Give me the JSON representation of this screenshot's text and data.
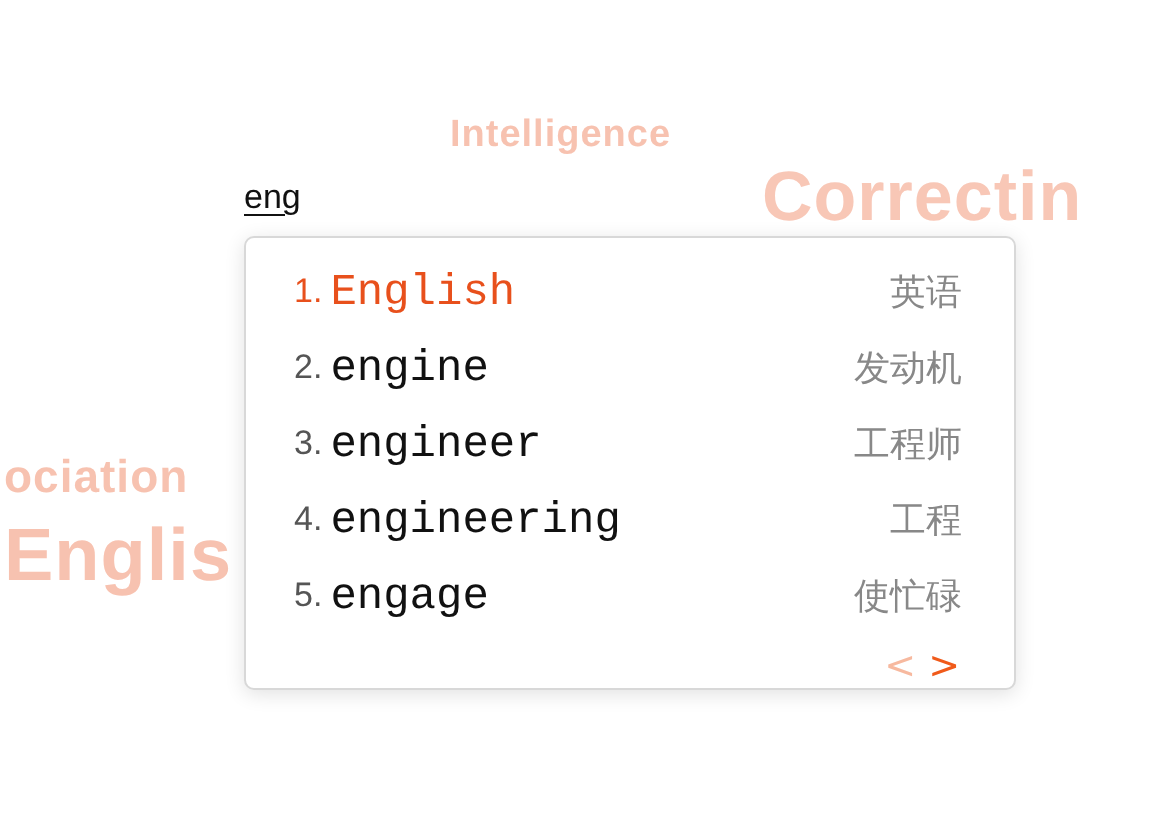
{
  "background_words": [
    {
      "text": "Intelligence",
      "kind": "small"
    },
    {
      "text": "Correctin",
      "kind": "large"
    },
    {
      "text": "ociation",
      "kind": "medium"
    },
    {
      "text": "Englis",
      "kind": "huge"
    }
  ],
  "input": {
    "value": "eng"
  },
  "suggestions": [
    {
      "number": "1.",
      "word": "English",
      "translation": "英语",
      "selected": true
    },
    {
      "number": "2.",
      "word": "engine",
      "translation": "发动机",
      "selected": false
    },
    {
      "number": "3.",
      "word": "engineer",
      "translation": "工程师",
      "selected": false
    },
    {
      "number": "4.",
      "word": "engineering",
      "translation": "工程",
      "selected": false
    },
    {
      "number": "5.",
      "word": "engage",
      "translation": "使忙碌",
      "selected": false
    }
  ],
  "pager": {
    "previous": {
      "label": "<",
      "disabled": true
    },
    "next": {
      "label": ">",
      "disabled": false
    }
  }
}
